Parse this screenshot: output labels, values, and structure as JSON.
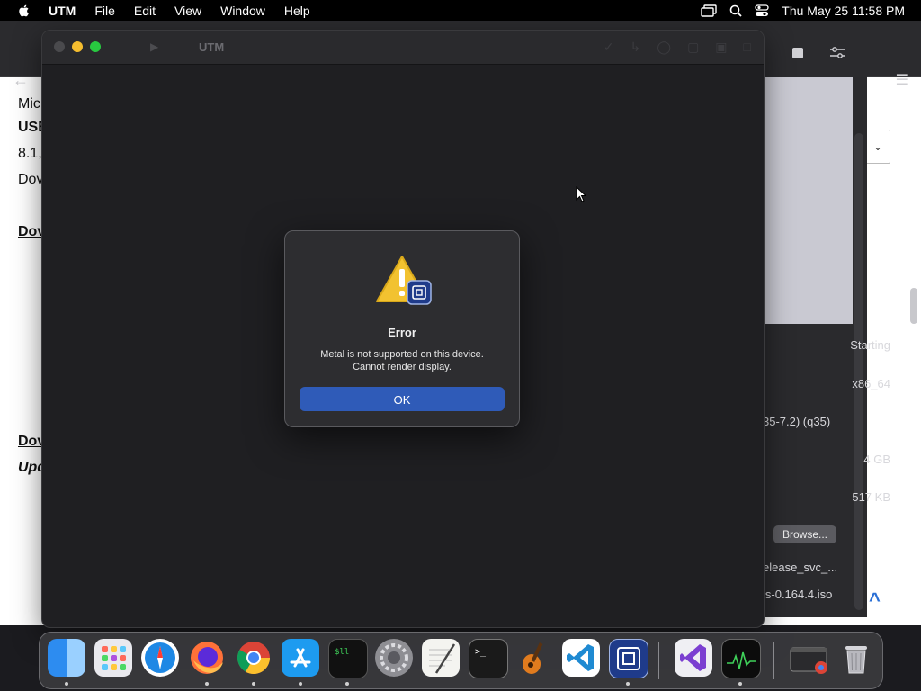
{
  "menubar": {
    "app_name": "UTM",
    "items": [
      "File",
      "Edit",
      "View",
      "Window",
      "Help"
    ],
    "clock": "Thu May 25  11:58 PM",
    "icons": [
      "apple-icon",
      "display-mirror-icon",
      "search-icon",
      "control-center-icon"
    ]
  },
  "background_doc": {
    "lines": [
      {
        "text": "Mic"
      },
      {
        "text": "USB"
      },
      {
        "text": "8.1,"
      },
      {
        "text": "Dov"
      },
      {
        "text": "Dov"
      },
      {
        "text": "Dov"
      },
      {
        "text": "Upd"
      }
    ]
  },
  "side_panel": {
    "status": "Starting",
    "arch": "x86_64",
    "machine": "35-7.2) (q35)",
    "memory": "4 GB",
    "size": "517 KB",
    "browse_label": "Browse...",
    "file1": "elease_svc_...",
    "file2": "ls-0.164.4.iso"
  },
  "utm_window": {
    "title": "UTM"
  },
  "alert": {
    "title": "Error",
    "message_line1": "Metal is not supported on this device.",
    "message_line2": "Cannot render display.",
    "ok_label": "OK"
  },
  "dock": {
    "apps": [
      "finder-icon",
      "launchpad-icon",
      "safari-icon",
      "firefox-icon",
      "chrome-icon",
      "app-store-icon",
      "activity-terminal-icon",
      "system-settings-icon",
      "textedit-icon",
      "terminal-icon",
      "garageband-icon",
      "vscode-icon",
      "utm-icon",
      "visual-studio-icon",
      "activity-monitor-icon",
      "chrome-app-icon",
      "trash-icon"
    ]
  },
  "colors": {
    "accent": "#2f5bb8",
    "alert_bg": "#2d2d30",
    "window_bg": "#1f1f22",
    "traffic_min": "#f5bd2f",
    "traffic_max": "#28c840"
  }
}
